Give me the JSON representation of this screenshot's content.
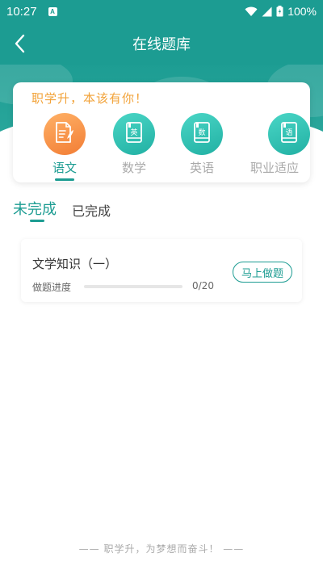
{
  "status_bar": {
    "time": "10:27",
    "notification_badge": "A",
    "battery": "100%"
  },
  "header": {
    "title": "在线题库"
  },
  "card": {
    "slogan": "职学升，本该有你！",
    "categories": [
      {
        "label": "语文",
        "icon": "document-pen-icon",
        "active": true
      },
      {
        "label": "数学",
        "icon": "book-math-icon",
        "active": false,
        "badge": "数"
      },
      {
        "label": "英语",
        "icon": "book-english-icon",
        "active": false,
        "badge": "英"
      },
      {
        "label": "职业适应",
        "icon": "book-career-icon",
        "active": false,
        "badge": "语"
      }
    ]
  },
  "tabs": [
    {
      "label": "未完成",
      "active": true
    },
    {
      "label": "已完成",
      "active": false
    }
  ],
  "items": [
    {
      "title": "文学知识（一）",
      "progress_label": "做题进度",
      "progress_done": 0,
      "progress_total": 20,
      "progress_text": "0/20",
      "action_label": "马上做题"
    }
  ],
  "footer": {
    "text": "—— 职学升，为梦想而奋斗！ ——"
  },
  "colors": {
    "primary": "#1c9c92",
    "accent_orange": "#f2a33a",
    "muted": "#aaaaaa"
  }
}
